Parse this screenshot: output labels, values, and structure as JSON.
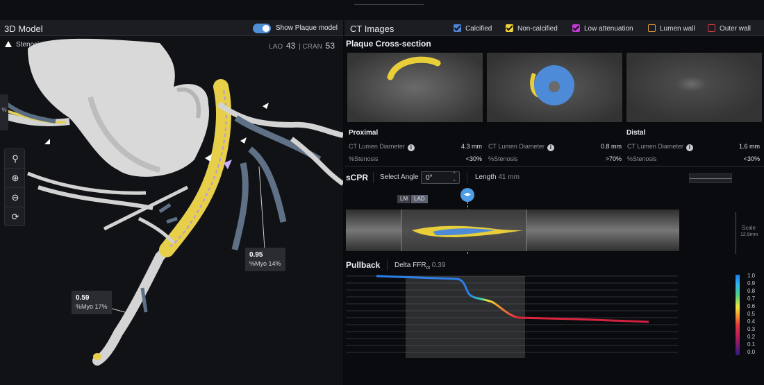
{
  "left_panel": {
    "title": "3D Model",
    "toggle_label": "Show Plaque model",
    "stenosis_marker": "Stenosis Marker",
    "lao_label": "LAO",
    "lao_value": "43",
    "cran_label": "CRAN",
    "cran_value": "53",
    "side_tab": "%",
    "labels": [
      {
        "value": "0.95",
        "myo": "%Myo 14%"
      },
      {
        "value": "0.59",
        "myo": "%Myo 17%"
      }
    ],
    "tools": [
      "pin-icon",
      "zoom-in-icon",
      "zoom-out-icon",
      "rotate-icon"
    ]
  },
  "right_panel": {
    "title": "CT Images",
    "legend": [
      {
        "label": "Calcified",
        "color": "#4d86d8",
        "checked": true
      },
      {
        "label": "Non-calcified",
        "color": "#f2d23a",
        "checked": true
      },
      {
        "label": "Low attenuation",
        "color": "#c33ad6",
        "checked": true
      },
      {
        "label": "Lumen wall",
        "color": "#e09a3a",
        "checked": false
      },
      {
        "label": "Outer wall",
        "color": "#d93a3a",
        "checked": false
      }
    ],
    "cross_section": {
      "title": "Plaque Cross-section",
      "sections": [
        {
          "name": "Proximal",
          "lumen_label": "CT Lumen Diameter",
          "lumen": "4.3 mm",
          "stenosis_label": "%Stenosis",
          "stenosis": "<30%"
        },
        {
          "name": "",
          "lumen_label": "CT Lumen Diameter",
          "lumen": "0.8 mm",
          "stenosis_label": "%Stenosis",
          "stenosis": ">70%"
        },
        {
          "name": "Distal",
          "lumen_label": "CT Lumen Diameter",
          "lumen": "1.6 mm",
          "stenosis_label": "%Stenosis",
          "stenosis": "<30%"
        }
      ]
    },
    "scpr": {
      "title": "sCPR",
      "select_angle_label": "Select Angle",
      "angle_value": "0°",
      "length_label": "Length",
      "length_value": "41 mm",
      "tags": [
        "LM",
        "LAD"
      ],
      "scale_label": "Scale",
      "scale_value": "12.8mm"
    },
    "pullback": {
      "title": "Pullback",
      "delta_label": "Delta FFR",
      "delta_sub": "ct",
      "delta_value": "0.39",
      "colorbar_ticks": [
        "1.0",
        "0.9",
        "0.8",
        "0.7",
        "0.6",
        "0.5",
        "0.4",
        "0.3",
        "0.2",
        "0.1",
        "0.0"
      ]
    }
  }
}
